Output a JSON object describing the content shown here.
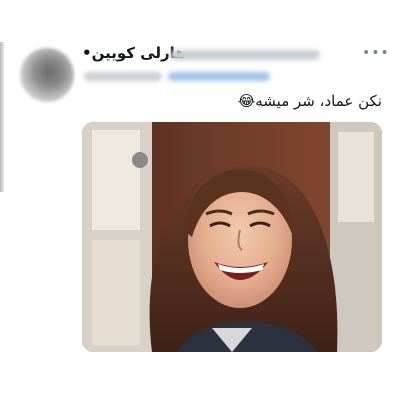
{
  "tweet": {
    "display_name": "هارلی کویین•",
    "text": "نکن عماد، شر میشه😂",
    "more_icon": "more-dots-icon",
    "media_icon": "laughing-woman-photo"
  }
}
